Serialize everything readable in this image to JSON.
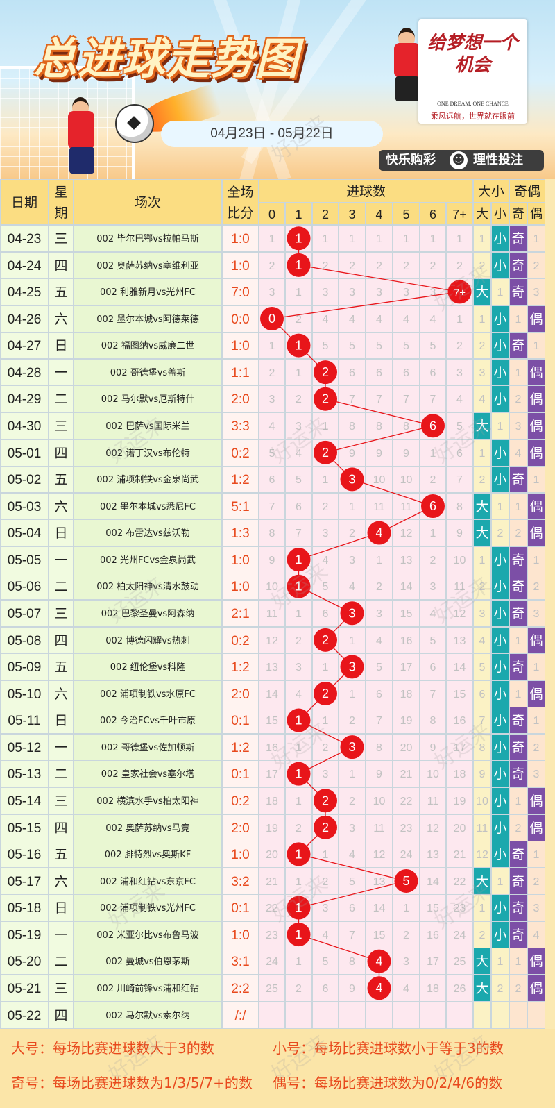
{
  "banner": {
    "title": "总进球走势图",
    "date_range": "04月23日 - 05月22日",
    "logo_line1": "给梦想一个",
    "logo_line2": "机会",
    "logo_en": "ONE DREAM, ONE CHANCE",
    "logo_sub": "乘风远航，世界就在眼前",
    "slogan_left": "快乐购彩",
    "slogan_face": "☻",
    "slogan_right": "理性投注",
    "watermark": "好运来"
  },
  "table": {
    "headers": {
      "date": "日期",
      "weekday": "星期",
      "match": "场次",
      "score": "全场比分",
      "goals": "进球数",
      "bigsmall": "大小",
      "oddeven": "奇偶"
    },
    "goal_columns": [
      "0",
      "1",
      "2",
      "3",
      "4",
      "5",
      "6",
      "7+"
    ],
    "bs_columns": [
      "大",
      "小"
    ],
    "oe_columns": [
      "奇",
      "偶"
    ],
    "rows": [
      {
        "date": "04-23",
        "weekday": "三",
        "match": "002 毕尔巴鄂vs拉帕马斯",
        "score": "1:0",
        "goal": "1",
        "miss": [
          "1",
          "",
          "1",
          "1",
          "1",
          "1",
          "1",
          "1"
        ],
        "bs": [
          "1",
          "小"
        ],
        "oe": [
          "奇",
          "1"
        ]
      },
      {
        "date": "04-24",
        "weekday": "四",
        "match": "002 奥萨苏纳vs塞维利亚",
        "score": "1:0",
        "goal": "1",
        "miss": [
          "2",
          "",
          "2",
          "2",
          "2",
          "2",
          "2",
          "2"
        ],
        "bs": [
          "2",
          "小"
        ],
        "oe": [
          "奇",
          "2"
        ]
      },
      {
        "date": "04-25",
        "weekday": "五",
        "match": "002 利雅新月vs光州FC",
        "score": "7:0",
        "goal": "7+",
        "miss": [
          "3",
          "1",
          "3",
          "3",
          "3",
          "3",
          "3",
          ""
        ],
        "bs": [
          "大",
          "1"
        ],
        "oe": [
          "奇",
          "3"
        ]
      },
      {
        "date": "04-26",
        "weekday": "六",
        "match": "002 墨尔本城vs阿德莱德",
        "score": "0:0",
        "goal": "0",
        "miss": [
          "",
          "2",
          "4",
          "4",
          "4",
          "4",
          "4",
          "1"
        ],
        "bs": [
          "1",
          "小"
        ],
        "oe": [
          "1",
          "偶"
        ]
      },
      {
        "date": "04-27",
        "weekday": "日",
        "match": "002 福图纳vs威廉二世",
        "score": "1:0",
        "goal": "1",
        "miss": [
          "1",
          "",
          "5",
          "5",
          "5",
          "5",
          "5",
          "2"
        ],
        "bs": [
          "2",
          "小"
        ],
        "oe": [
          "奇",
          "1"
        ]
      },
      {
        "date": "04-28",
        "weekday": "一",
        "match": "002 哥德堡vs盖斯",
        "score": "1:1",
        "goal": "2",
        "miss": [
          "2",
          "1",
          "",
          "6",
          "6",
          "6",
          "6",
          "3"
        ],
        "bs": [
          "3",
          "小"
        ],
        "oe": [
          "1",
          "偶"
        ]
      },
      {
        "date": "04-29",
        "weekday": "二",
        "match": "002 马尔默vs厄斯特什",
        "score": "2:0",
        "goal": "2",
        "miss": [
          "3",
          "2",
          "",
          "7",
          "7",
          "7",
          "7",
          "4"
        ],
        "bs": [
          "4",
          "小"
        ],
        "oe": [
          "2",
          "偶"
        ]
      },
      {
        "date": "04-30",
        "weekday": "三",
        "match": "002 巴萨vs国际米兰",
        "score": "3:3",
        "goal": "6",
        "miss": [
          "4",
          "3",
          "1",
          "8",
          "8",
          "8",
          "",
          "5"
        ],
        "bs": [
          "大",
          "1"
        ],
        "oe": [
          "3",
          "偶"
        ]
      },
      {
        "date": "05-01",
        "weekday": "四",
        "match": "002 诺丁汉vs布伦特",
        "score": "0:2",
        "goal": "2",
        "miss": [
          "5",
          "4",
          "",
          "9",
          "9",
          "9",
          "1",
          "6"
        ],
        "bs": [
          "1",
          "小"
        ],
        "oe": [
          "4",
          "偶"
        ]
      },
      {
        "date": "05-02",
        "weekday": "五",
        "match": "002 浦项制铁vs金泉尚武",
        "score": "1:2",
        "goal": "3",
        "miss": [
          "6",
          "5",
          "1",
          "",
          "10",
          "10",
          "2",
          "7"
        ],
        "bs": [
          "2",
          "小"
        ],
        "oe": [
          "奇",
          "1"
        ]
      },
      {
        "date": "05-03",
        "weekday": "六",
        "match": "002 墨尔本城vs悉尼FC",
        "score": "5:1",
        "goal": "6",
        "miss": [
          "7",
          "6",
          "2",
          "1",
          "11",
          "11",
          "",
          "8"
        ],
        "bs": [
          "大",
          "1"
        ],
        "oe": [
          "1",
          "偶"
        ]
      },
      {
        "date": "05-04",
        "weekday": "日",
        "match": "002 布雷达vs兹沃勒",
        "score": "1:3",
        "goal": "4",
        "miss": [
          "8",
          "7",
          "3",
          "2",
          "",
          "12",
          "1",
          "9"
        ],
        "bs": [
          "大",
          "2"
        ],
        "oe": [
          "2",
          "偶"
        ]
      },
      {
        "date": "05-05",
        "weekday": "一",
        "match": "002 光州FCvs金泉尚武",
        "score": "1:0",
        "goal": "1",
        "miss": [
          "9",
          "",
          "4",
          "3",
          "1",
          "13",
          "2",
          "10"
        ],
        "bs": [
          "1",
          "小"
        ],
        "oe": [
          "奇",
          "1"
        ]
      },
      {
        "date": "05-06",
        "weekday": "二",
        "match": "002 柏太阳神vs清水鼓动",
        "score": "1:0",
        "goal": "1",
        "miss": [
          "10",
          "",
          "5",
          "4",
          "2",
          "14",
          "3",
          "11"
        ],
        "bs": [
          "2",
          "小"
        ],
        "oe": [
          "奇",
          "2"
        ]
      },
      {
        "date": "05-07",
        "weekday": "三",
        "match": "002 巴黎圣曼vs阿森纳",
        "score": "2:1",
        "goal": "3",
        "miss": [
          "11",
          "1",
          "6",
          "",
          "3",
          "15",
          "4",
          "12"
        ],
        "bs": [
          "3",
          "小"
        ],
        "oe": [
          "奇",
          "3"
        ]
      },
      {
        "date": "05-08",
        "weekday": "四",
        "match": "002 博德闪耀vs热刺",
        "score": "0:2",
        "goal": "2",
        "miss": [
          "12",
          "2",
          "",
          "1",
          "4",
          "16",
          "5",
          "13"
        ],
        "bs": [
          "4",
          "小"
        ],
        "oe": [
          "1",
          "偶"
        ]
      },
      {
        "date": "05-09",
        "weekday": "五",
        "match": "002 纽伦堡vs科隆",
        "score": "1:2",
        "goal": "3",
        "miss": [
          "13",
          "3",
          "1",
          "",
          "5",
          "17",
          "6",
          "14"
        ],
        "bs": [
          "5",
          "小"
        ],
        "oe": [
          "奇",
          "1"
        ]
      },
      {
        "date": "05-10",
        "weekday": "六",
        "match": "002 浦项制铁vs水原FC",
        "score": "2:0",
        "goal": "2",
        "miss": [
          "14",
          "4",
          "",
          "1",
          "6",
          "18",
          "7",
          "15"
        ],
        "bs": [
          "6",
          "小"
        ],
        "oe": [
          "1",
          "偶"
        ]
      },
      {
        "date": "05-11",
        "weekday": "日",
        "match": "002 今治FCvs千叶市原",
        "score": "0:1",
        "goal": "1",
        "miss": [
          "15",
          "",
          "1",
          "2",
          "7",
          "19",
          "8",
          "16"
        ],
        "bs": [
          "7",
          "小"
        ],
        "oe": [
          "奇",
          "1"
        ]
      },
      {
        "date": "05-12",
        "weekday": "一",
        "match": "002 哥德堡vs佐加顿斯",
        "score": "1:2",
        "goal": "3",
        "miss": [
          "16",
          "1",
          "2",
          "",
          "8",
          "20",
          "9",
          "17"
        ],
        "bs": [
          "8",
          "小"
        ],
        "oe": [
          "奇",
          "2"
        ]
      },
      {
        "date": "05-13",
        "weekday": "二",
        "match": "002 皇家社会vs塞尔塔",
        "score": "0:1",
        "goal": "1",
        "miss": [
          "17",
          "",
          "3",
          "1",
          "9",
          "21",
          "10",
          "18"
        ],
        "bs": [
          "9",
          "小"
        ],
        "oe": [
          "奇",
          "3"
        ]
      },
      {
        "date": "05-14",
        "weekday": "三",
        "match": "002 横滨水手vs柏太阳神",
        "score": "0:2",
        "goal": "2",
        "miss": [
          "18",
          "1",
          "",
          "2",
          "10",
          "22",
          "11",
          "19"
        ],
        "bs": [
          "10",
          "小"
        ],
        "oe": [
          "1",
          "偶"
        ]
      },
      {
        "date": "05-15",
        "weekday": "四",
        "match": "002 奥萨苏纳vs马竞",
        "score": "2:0",
        "goal": "2",
        "miss": [
          "19",
          "2",
          "",
          "3",
          "11",
          "23",
          "12",
          "20"
        ],
        "bs": [
          "11",
          "小"
        ],
        "oe": [
          "2",
          "偶"
        ]
      },
      {
        "date": "05-16",
        "weekday": "五",
        "match": "002 腓特烈vs奥斯KF",
        "score": "1:0",
        "goal": "1",
        "miss": [
          "20",
          "",
          "1",
          "4",
          "12",
          "24",
          "13",
          "21"
        ],
        "bs": [
          "12",
          "小"
        ],
        "oe": [
          "奇",
          "1"
        ]
      },
      {
        "date": "05-17",
        "weekday": "六",
        "match": "002 浦和红钻vs东京FC",
        "score": "3:2",
        "goal": "5",
        "miss": [
          "21",
          "1",
          "2",
          "5",
          "13",
          "",
          "14",
          "22"
        ],
        "bs": [
          "大",
          "1"
        ],
        "oe": [
          "奇",
          "2"
        ]
      },
      {
        "date": "05-18",
        "weekday": "日",
        "match": "002 浦项制铁vs光州FC",
        "score": "0:1",
        "goal": "1",
        "miss": [
          "22",
          "",
          "3",
          "6",
          "14",
          "1",
          "15",
          "23"
        ],
        "bs": [
          "1",
          "小"
        ],
        "oe": [
          "奇",
          "3"
        ]
      },
      {
        "date": "05-19",
        "weekday": "一",
        "match": "002 米亚尔比vs布鲁马波",
        "score": "1:0",
        "goal": "1",
        "miss": [
          "23",
          "",
          "4",
          "7",
          "15",
          "2",
          "16",
          "24"
        ],
        "bs": [
          "2",
          "小"
        ],
        "oe": [
          "奇",
          "4"
        ]
      },
      {
        "date": "05-20",
        "weekday": "二",
        "match": "002 曼城vs伯恩茅斯",
        "score": "3:1",
        "goal": "4",
        "miss": [
          "24",
          "1",
          "5",
          "8",
          "",
          "3",
          "17",
          "25"
        ],
        "bs": [
          "大",
          "1"
        ],
        "oe": [
          "1",
          "偶"
        ]
      },
      {
        "date": "05-21",
        "weekday": "三",
        "match": "002 川崎前锋vs浦和红钻",
        "score": "2:2",
        "goal": "4",
        "miss": [
          "25",
          "2",
          "6",
          "9",
          "",
          "4",
          "18",
          "26"
        ],
        "bs": [
          "大",
          "2"
        ],
        "oe": [
          "2",
          "偶"
        ]
      },
      {
        "date": "05-22",
        "weekday": "四",
        "match": "002 马尔默vs索尔纳",
        "score": "/:/",
        "goal": "",
        "miss": [
          "",
          "",
          "",
          "",
          "",
          "",
          "",
          ""
        ],
        "bs": [
          "",
          ""
        ],
        "oe": [
          "",
          ""
        ]
      }
    ]
  },
  "legend": {
    "big_key": "大号：",
    "big_text": "每场比赛进球数大于3的数",
    "small_key": "小号：",
    "small_text": "每场比赛进球数小于等于3的数",
    "odd_key": "奇号：",
    "odd_text": "每场比赛进球数为1/3/5/7+的数",
    "even_key": "偶号：",
    "even_text": "每场比赛进球数为0/2/4/6的数"
  },
  "colors": {
    "ball": "#e8151a",
    "line": "#e8151a",
    "big_small_fill": "#1ba8ad",
    "odd_even_fill": "#7c4fa6",
    "score_text": "#e8491d"
  },
  "chart_data": {
    "type": "table",
    "title": "总进球走势图",
    "categories": [
      "04-23",
      "04-24",
      "04-25",
      "04-26",
      "04-27",
      "04-28",
      "04-29",
      "04-30",
      "05-01",
      "05-02",
      "05-03",
      "05-04",
      "05-05",
      "05-06",
      "05-07",
      "05-08",
      "05-09",
      "05-10",
      "05-11",
      "05-12",
      "05-13",
      "05-14",
      "05-15",
      "05-16",
      "05-17",
      "05-18",
      "05-19",
      "05-20",
      "05-21",
      "05-22"
    ],
    "series": [
      {
        "name": "进球数",
        "values": [
          "1",
          "1",
          "7+",
          "0",
          "1",
          "2",
          "2",
          "6",
          "2",
          "3",
          "6",
          "4",
          "1",
          "1",
          "3",
          "2",
          "3",
          "2",
          "1",
          "3",
          "1",
          "2",
          "2",
          "1",
          "5",
          "1",
          "1",
          "4",
          "4",
          null
        ]
      }
    ]
  }
}
